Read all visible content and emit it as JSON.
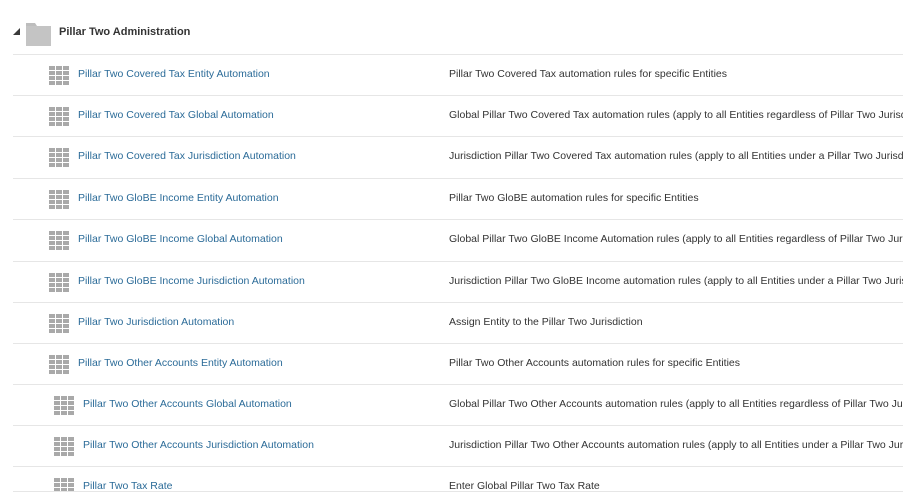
{
  "section": {
    "title": "Pillar Two Administration",
    "toggle_icon": "collapse-triangle-icon",
    "folder_icon": "folder-icon"
  },
  "rows": [
    {
      "name": "Pillar Two Covered Tax Entity Automation",
      "description": "Pillar Two Covered Tax automation rules for specific Entities"
    },
    {
      "name": "Pillar Two Covered Tax Global Automation",
      "description": "Global Pillar Two Covered Tax automation rules (apply to all Entities regardless of Pillar Two Jurisdic"
    },
    {
      "name": "Pillar Two Covered Tax Jurisdiction Automation",
      "description": "Jurisdiction Pillar Two Covered Tax automation rules (apply to all Entities under a Pillar Two Jurisdic"
    },
    {
      "name": "Pillar Two GloBE Income Entity Automation",
      "description": "Pillar Two GloBE automation rules for specific Entities"
    },
    {
      "name": "Pillar Two GloBE Income Global Automation",
      "description": "Global Pillar Two GloBE Income Automation rules (apply to all Entities regardless of Pillar Two Jurisd"
    },
    {
      "name": "Pillar Two GloBE Income Jurisdiction Automation",
      "description": "Jurisdiction Pillar Two GloBE Income automation rules (apply to all Entities under a Pillar Two Jurisd"
    },
    {
      "name": "Pillar Two Jurisdiction Automation",
      "description": "Assign Entity to the Pillar Two Jurisdiction"
    },
    {
      "name": "Pillar Two Other Accounts Entity Automation",
      "description": "Pillar Two Other Accounts automation rules for specific Entities"
    },
    {
      "name": "Pillar Two Other Accounts Global Automation",
      "description": "Global Pillar Two Other Accounts automation rules (apply to all Entities regardless of Pillar Two Juriso"
    },
    {
      "name": "Pillar Two Other Accounts Jurisdiction Automation",
      "description": "Jurisdiction Pillar Two Other Accounts automation rules (apply to all Entities under a Pillar Two Juriso"
    },
    {
      "name": "Pillar Two Tax Rate",
      "description": "Enter Global Pillar Two Tax Rate"
    }
  ],
  "colors": {
    "link": "#2b6b98",
    "text": "#333333",
    "icon": "#a9a9a9",
    "divider": "#e6e6e6"
  },
  "row_icon": "form-grid-icon"
}
